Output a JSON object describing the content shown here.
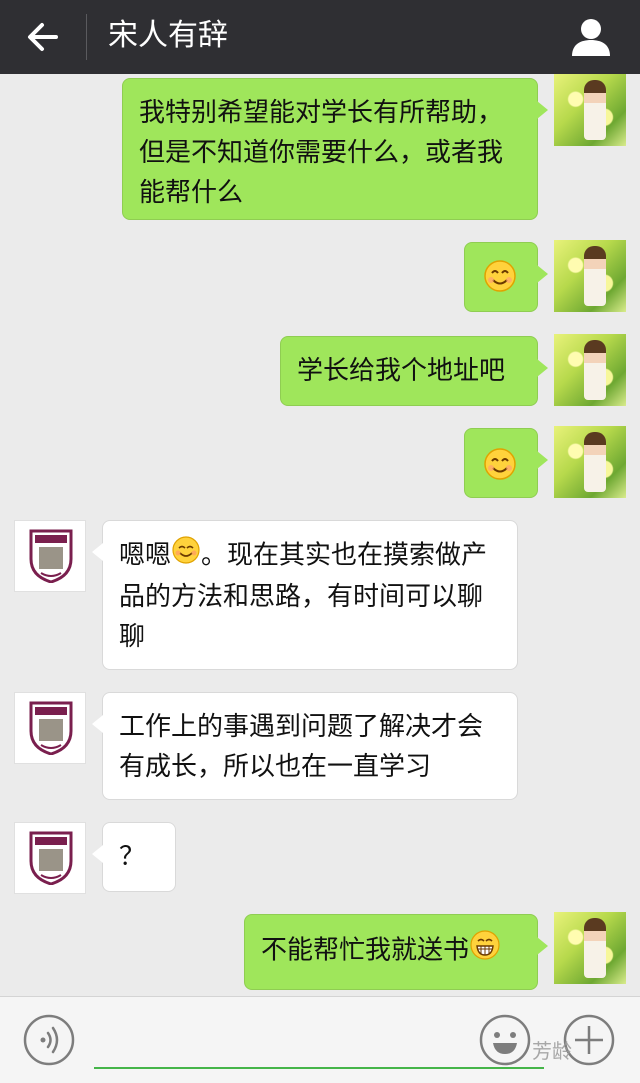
{
  "header": {
    "title": "宋人有辞",
    "back_icon": "arrow-left-icon",
    "profile_icon": "person-icon"
  },
  "messages": [
    {
      "side": "me",
      "text": "我特别希望能对学长有所帮助，但是不知道你需要什么，或者我能帮什么"
    },
    {
      "side": "me",
      "emoji": "smile-emoji"
    },
    {
      "side": "me",
      "text": "学长给我个地址吧"
    },
    {
      "side": "me",
      "emoji": "smile-emoji"
    },
    {
      "side": "them",
      "text_before": "嗯嗯",
      "emoji": "blush-emoji",
      "text_after": "。现在其实也在摸索做产品的方法和思路，有时间可以聊聊"
    },
    {
      "side": "them",
      "text": "工作上的事遇到问题了解决才会有成长，所以也在一直学习"
    },
    {
      "side": "them",
      "text": "？"
    },
    {
      "side": "me",
      "text": "不能帮忙我就送书",
      "emoji": "grin-emoji"
    }
  ],
  "bottom": {
    "voice_icon": "voice-icon",
    "emoji_icon": "smiley-icon",
    "plus_icon": "plus-circle-icon",
    "watermark": "芳龄"
  },
  "colors": {
    "header_bg": "#2f2f33",
    "chat_bg": "#ebebeb",
    "my_bubble": "#9fe65b",
    "their_bubble": "#ffffff",
    "input_underline": "#45b549"
  }
}
